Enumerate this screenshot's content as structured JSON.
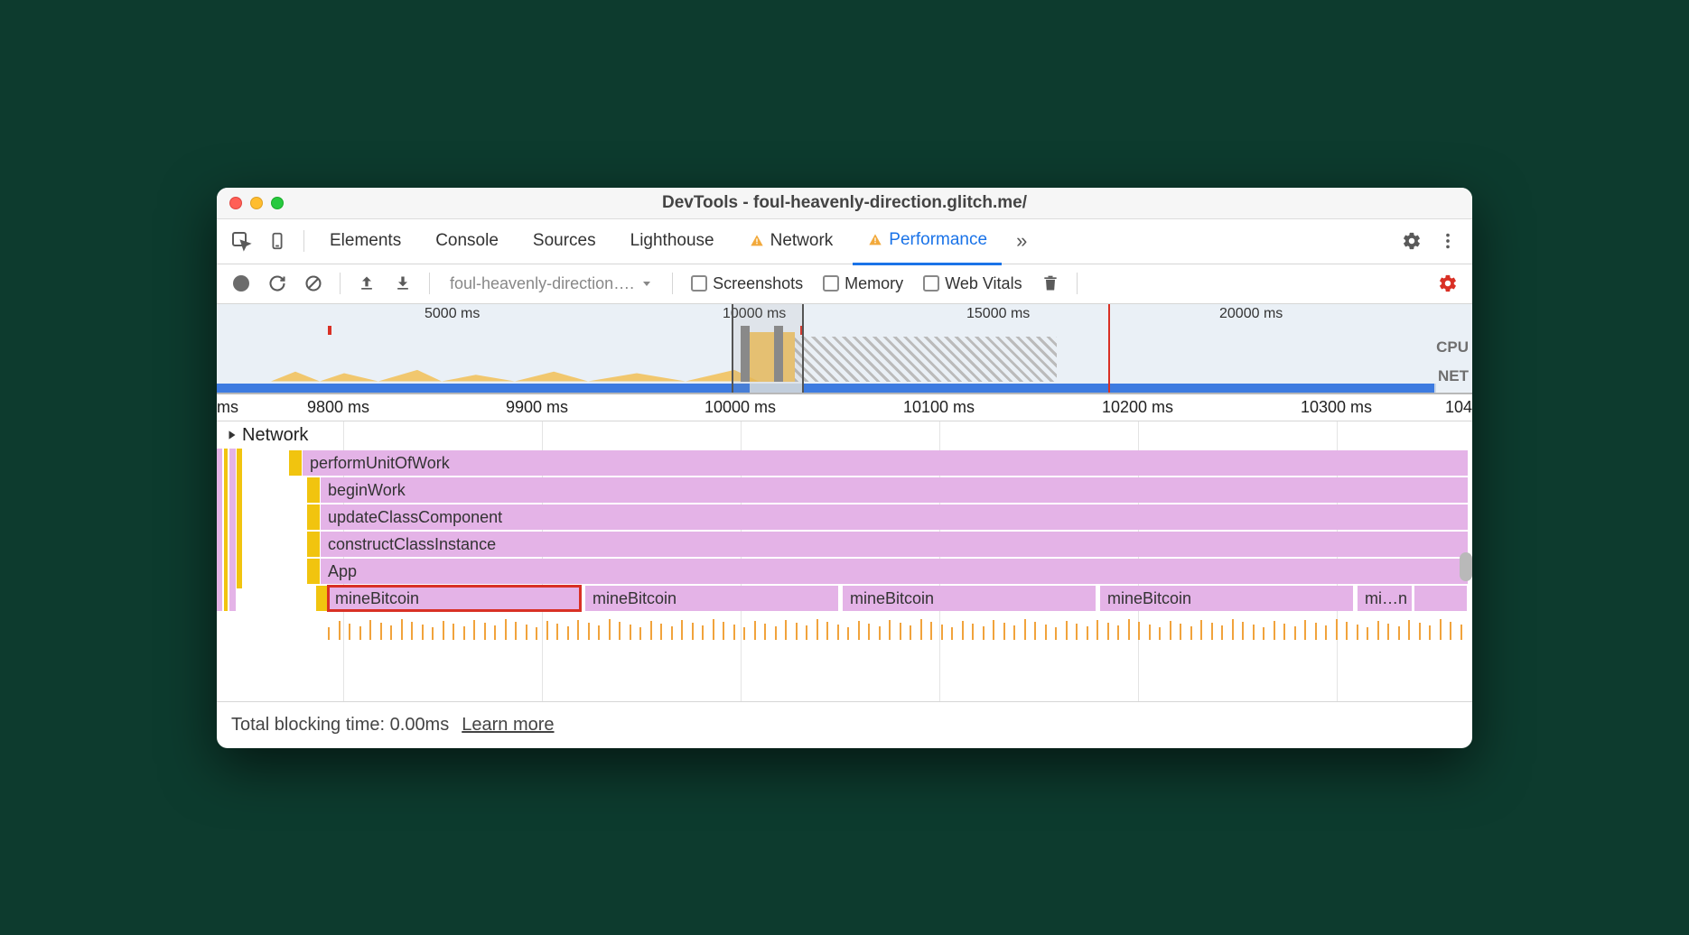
{
  "window": {
    "title": "DevTools - foul-heavenly-direction.glitch.me/"
  },
  "tabs": {
    "items": [
      {
        "label": "Elements",
        "warn": false
      },
      {
        "label": "Console",
        "warn": false
      },
      {
        "label": "Sources",
        "warn": false
      },
      {
        "label": "Lighthouse",
        "warn": false
      },
      {
        "label": "Network",
        "warn": true
      },
      {
        "label": "Performance",
        "warn": true,
        "active": true
      }
    ]
  },
  "toolbar": {
    "select_value": "foul-heavenly-direction….",
    "screenshots": "Screenshots",
    "memory": "Memory",
    "webvitals": "Web Vitals"
  },
  "overview_ticks": {
    "t1": "5000 ms",
    "t2": "10000 ms",
    "t3": "15000 ms",
    "t4": "20000 ms"
  },
  "overview_labels": {
    "cpu": "CPU",
    "net": "NET"
  },
  "ruler": {
    "r0": "ms",
    "r1": "9800 ms",
    "r2": "9900 ms",
    "r3": "10000 ms",
    "r4": "10100 ms",
    "r5": "10200 ms",
    "r6": "10300 ms",
    "r7": "104"
  },
  "tracks": {
    "network_header": "Network",
    "row0": "performUnitOfWork",
    "row1": "beginWork",
    "row2": "updateClassComponent",
    "row3": "constructClassInstance",
    "row4": "App",
    "row5a": "mineBitcoin",
    "row5b": "mineBitcoin",
    "row5c": "mineBitcoin",
    "row5d": "mineBitcoin",
    "row5e": "mi…n"
  },
  "footer": {
    "tbt": "Total blocking time: 0.00ms",
    "learn": "Learn more"
  }
}
